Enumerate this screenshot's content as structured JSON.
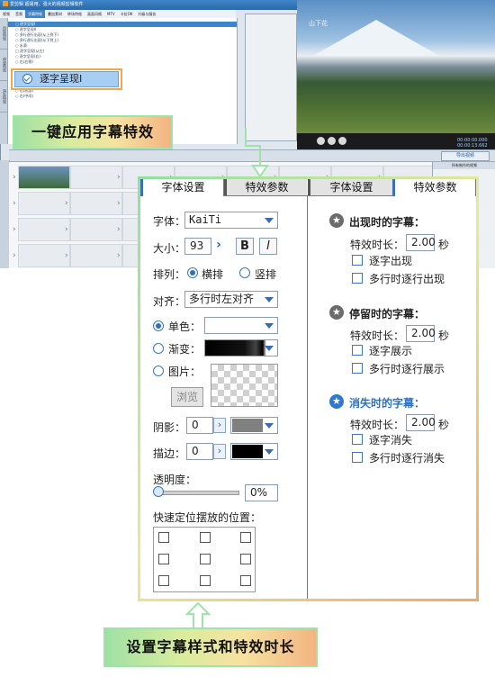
{
  "app": {
    "title": "爱剪辑   超易用、强大的视频剪辑软件",
    "menu": [
      "视频",
      "音频",
      "字幕特效",
      "叠加素材",
      "转场特效",
      "画面风格",
      "MTV",
      "卡拉OK",
      "升级与服务"
    ],
    "active_menu": "字幕特效",
    "side_tabs": [
      "出现特效",
      "停留特效",
      "消失特效"
    ],
    "tree_rows": [
      "□ 逐字呈现I",
      "○ 逐字呈现II",
      "○ 多行逐行出现(从上到下)",
      "○ 多行逐行出现(从下到上)",
      "○ 水滴",
      "□ 逐字呈现(从左)",
      "○ 逐字呈现(右)",
      "○ 右(右侧)",
      "○ 右(底部)",
      "○ 右(中间)"
    ],
    "preview_caption": "山下花",
    "timecode": [
      "00:00:00.000",
      "00:00:13.662"
    ],
    "export_label": "导出视频",
    "right_pane_head": "所有制作的视频"
  },
  "callouts": {
    "apply": "一键应用字幕特效",
    "effect_tag": "逐字呈现I",
    "settings": "设置字幕样式和特效时长"
  },
  "tabs": {
    "left": [
      "字体设置",
      "特效参数"
    ],
    "right": [
      "字体设置",
      "特效参数"
    ]
  },
  "font": {
    "font_label": "字体：",
    "font_value": "KaiTi",
    "size_label": "大小：",
    "size_value": "93",
    "bold": "B",
    "italic": "I",
    "layout_label": "排列：",
    "horizontal": "横排",
    "vertical": "竖排",
    "align_label": "对齐：",
    "align_value": "多行时左对齐",
    "solid": "单色：",
    "gradient": "渐变：",
    "image": "图片：",
    "browse": "浏览",
    "shadow_label": "阴影：",
    "shadow_value": "0",
    "stroke_label": "描边：",
    "stroke_value": "0",
    "opacity_label": "透明度：",
    "opacity_value": "0%",
    "quick_pos_label": "快速定位摆放的位置：",
    "colors": {
      "shadow": "#808080",
      "stroke": "#000000",
      "solid": "#ffffff"
    }
  },
  "effects": {
    "appear": {
      "title": "出现时的字幕：",
      "duration_label": "特效时长：",
      "duration": "2.00",
      "unit": "秒",
      "opt1": "逐字出现",
      "opt2": "多行时逐行出现"
    },
    "stay": {
      "title": "停留时的字幕：",
      "duration_label": "特效时长：",
      "duration": "2.00",
      "unit": "秒",
      "opt1": "逐字展示",
      "opt2": "多行时逐行展示"
    },
    "disappear": {
      "title": "消失时的字幕：",
      "duration_label": "特效时长：",
      "duration": "2.00",
      "unit": "秒",
      "opt1": "逐字消失",
      "opt2": "多行时逐行消失"
    }
  }
}
